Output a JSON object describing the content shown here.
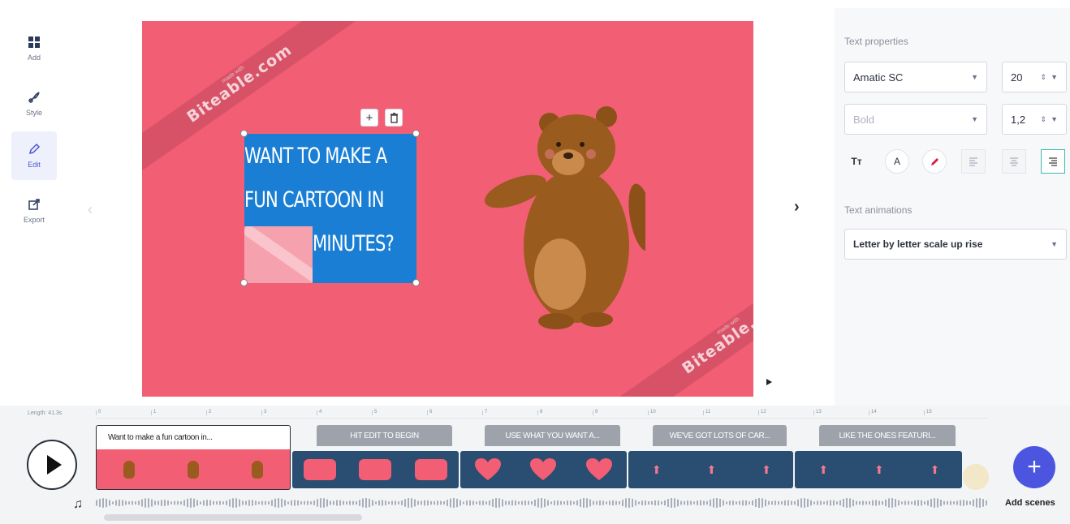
{
  "app": {
    "brand_colors": {
      "accent": "#4b55e0",
      "canvas": "#f25e74",
      "textbox": "#1a7fd4",
      "scene_strip": "#2a4d72"
    }
  },
  "leftbar": {
    "items": [
      {
        "label": "Add",
        "icon": "grid-icon"
      },
      {
        "label": "Style",
        "icon": "brush-icon"
      },
      {
        "label": "Edit",
        "icon": "pencil-icon",
        "active": true
      },
      {
        "label": "Export",
        "icon": "export-icon"
      }
    ]
  },
  "canvas": {
    "watermark_small": "made with",
    "watermark": "Biteable.com",
    "text_lines": [
      "WANT TO MAKE A",
      "FUN CARTOON IN",
      "MINUTES?"
    ],
    "add_symbol": "+",
    "delete_symbol": "🗑",
    "next_symbol": "›",
    "prev_symbol": "‹"
  },
  "right_panel": {
    "text_properties_title": "Text properties",
    "font_family": "Amatic SC",
    "font_size": "20",
    "font_weight": "Bold",
    "line_height": "1,2",
    "format_buttons": [
      "Tт",
      "A"
    ],
    "text_animations_title": "Text animations",
    "animation": "Letter by letter scale up rise"
  },
  "timeline": {
    "length_label": "Length: 41.3s",
    "ruler_ticks": [
      "0",
      "1",
      "2",
      "3",
      "4",
      "5",
      "6",
      "7",
      "8",
      "9",
      "10",
      "11",
      "12",
      "13",
      "14",
      "15"
    ],
    "scenes": [
      {
        "caption": "Want to make a fun cartoon in..."
      },
      {
        "caption": "HIT EDIT TO BEGIN"
      },
      {
        "caption": "USE WHAT YOU WANT A..."
      },
      {
        "caption": "WE'VE GOT LOTS OF CAR..."
      },
      {
        "caption": "LIKE THE ONES FEATURI..."
      }
    ],
    "add_scenes_label": "Add scenes",
    "add_symbol": "+"
  }
}
